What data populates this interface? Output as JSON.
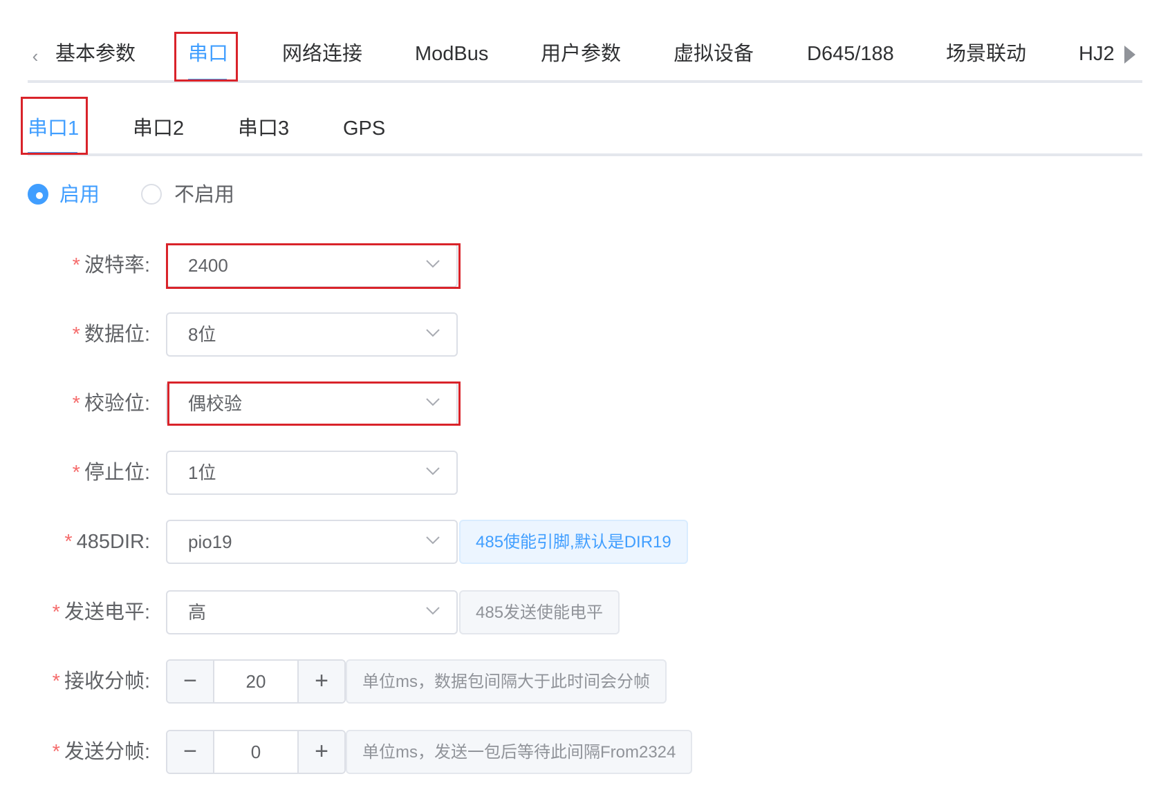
{
  "top_tabs": {
    "items": [
      {
        "label": "基本参数"
      },
      {
        "label": "串口"
      },
      {
        "label": "网络连接"
      },
      {
        "label": "ModBus"
      },
      {
        "label": "用户参数"
      },
      {
        "label": "虚拟设备"
      },
      {
        "label": "D645/188"
      },
      {
        "label": "场景联动"
      },
      {
        "label": "HJ2"
      }
    ],
    "active": "串口"
  },
  "sub_tabs": {
    "items": [
      {
        "label": "串口1"
      },
      {
        "label": "串口2"
      },
      {
        "label": "串口3"
      },
      {
        "label": "GPS"
      }
    ],
    "active": "串口1"
  },
  "enable": {
    "on_label": "启用",
    "off_label": "不启用",
    "selected": "启用"
  },
  "form": {
    "required_mark": "*",
    "baud_rate": {
      "label": "波特率:",
      "value": "2400"
    },
    "data_bits": {
      "label": "数据位:",
      "value": "8位"
    },
    "parity": {
      "label": "校验位:",
      "value": "偶校验"
    },
    "stop_bits": {
      "label": "停止位:",
      "value": "1位"
    },
    "dir485": {
      "label": "485DIR:",
      "value": "pio19",
      "hint": "485使能引脚,默认是DIR19"
    },
    "send_level": {
      "label": "发送电平:",
      "value": "高",
      "hint": "485发送使能电平"
    },
    "recv_frame": {
      "label": "接收分帧:",
      "value": "20",
      "minus": "−",
      "plus": "+",
      "hint": "单位ms，数据包间隔大于此时间会分帧"
    },
    "send_frame": {
      "label": "发送分帧:",
      "value": "0",
      "minus": "−",
      "plus": "+",
      "hint": "单位ms，发送一包后等待此间隔From2324"
    }
  },
  "colors": {
    "accent": "#409eff",
    "highlight": "#d9232a",
    "required": "#f56c6c"
  }
}
